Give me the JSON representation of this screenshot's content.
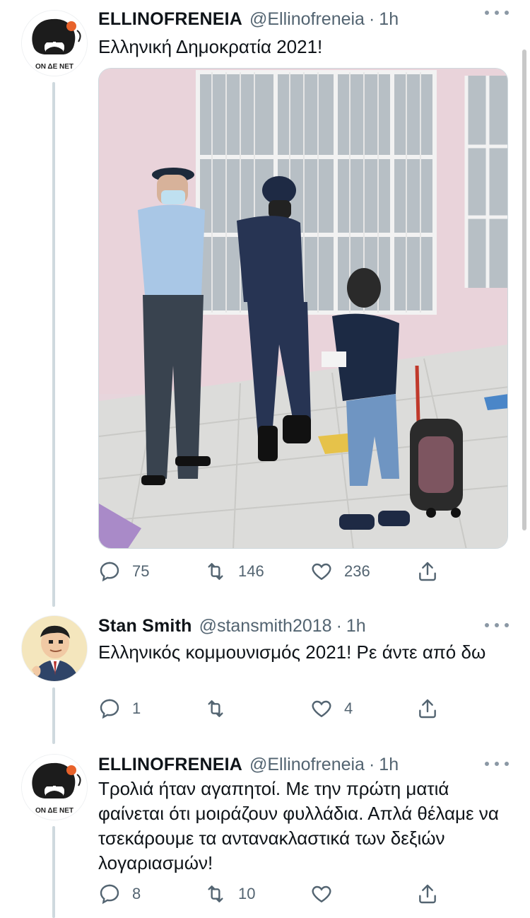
{
  "tweets": [
    {
      "name": "ELLINOFRENEIA",
      "handle": "@Ellinofreneia",
      "sep": "·",
      "time": "1h",
      "text": "Ελληνική Δημοκρατία 2021!",
      "avatar_label": "ΟΝ ΔΕ ΝΕΤ",
      "replies": "75",
      "retweets": "146",
      "likes": "236"
    },
    {
      "name": "Stan Smith",
      "handle": "@stansmith2018",
      "sep": "·",
      "time": "1h",
      "text": "Ελληνικός κομμουνισμός 2021! Ρε άντε από δω",
      "replies": "1",
      "retweets": "",
      "likes": "4"
    },
    {
      "name": "ELLINOFRENEIA",
      "handle": "@Ellinofreneia",
      "sep": "·",
      "time": "1h",
      "text": "Τρολιά ήταν αγαπητοί. Με την πρώτη ματιά φαίνεται ότι μοιράζουν φυλλάδια. Απλά θέλαμε να τσεκάρουμε τα αντανακλαστικά των δεξιών λογαριασμών!",
      "avatar_label": "ΟΝ ΔΕ ΝΕΤ",
      "replies": "8",
      "retweets": "10",
      "likes": ""
    }
  ],
  "icons": {
    "reply": "reply-icon",
    "retweet": "retweet-icon",
    "like": "heart-icon",
    "share": "share-icon",
    "more": "more-icon"
  },
  "colors": {
    "text": "#0f1419",
    "secondary": "#536471",
    "thread_line": "#cfd9de"
  }
}
